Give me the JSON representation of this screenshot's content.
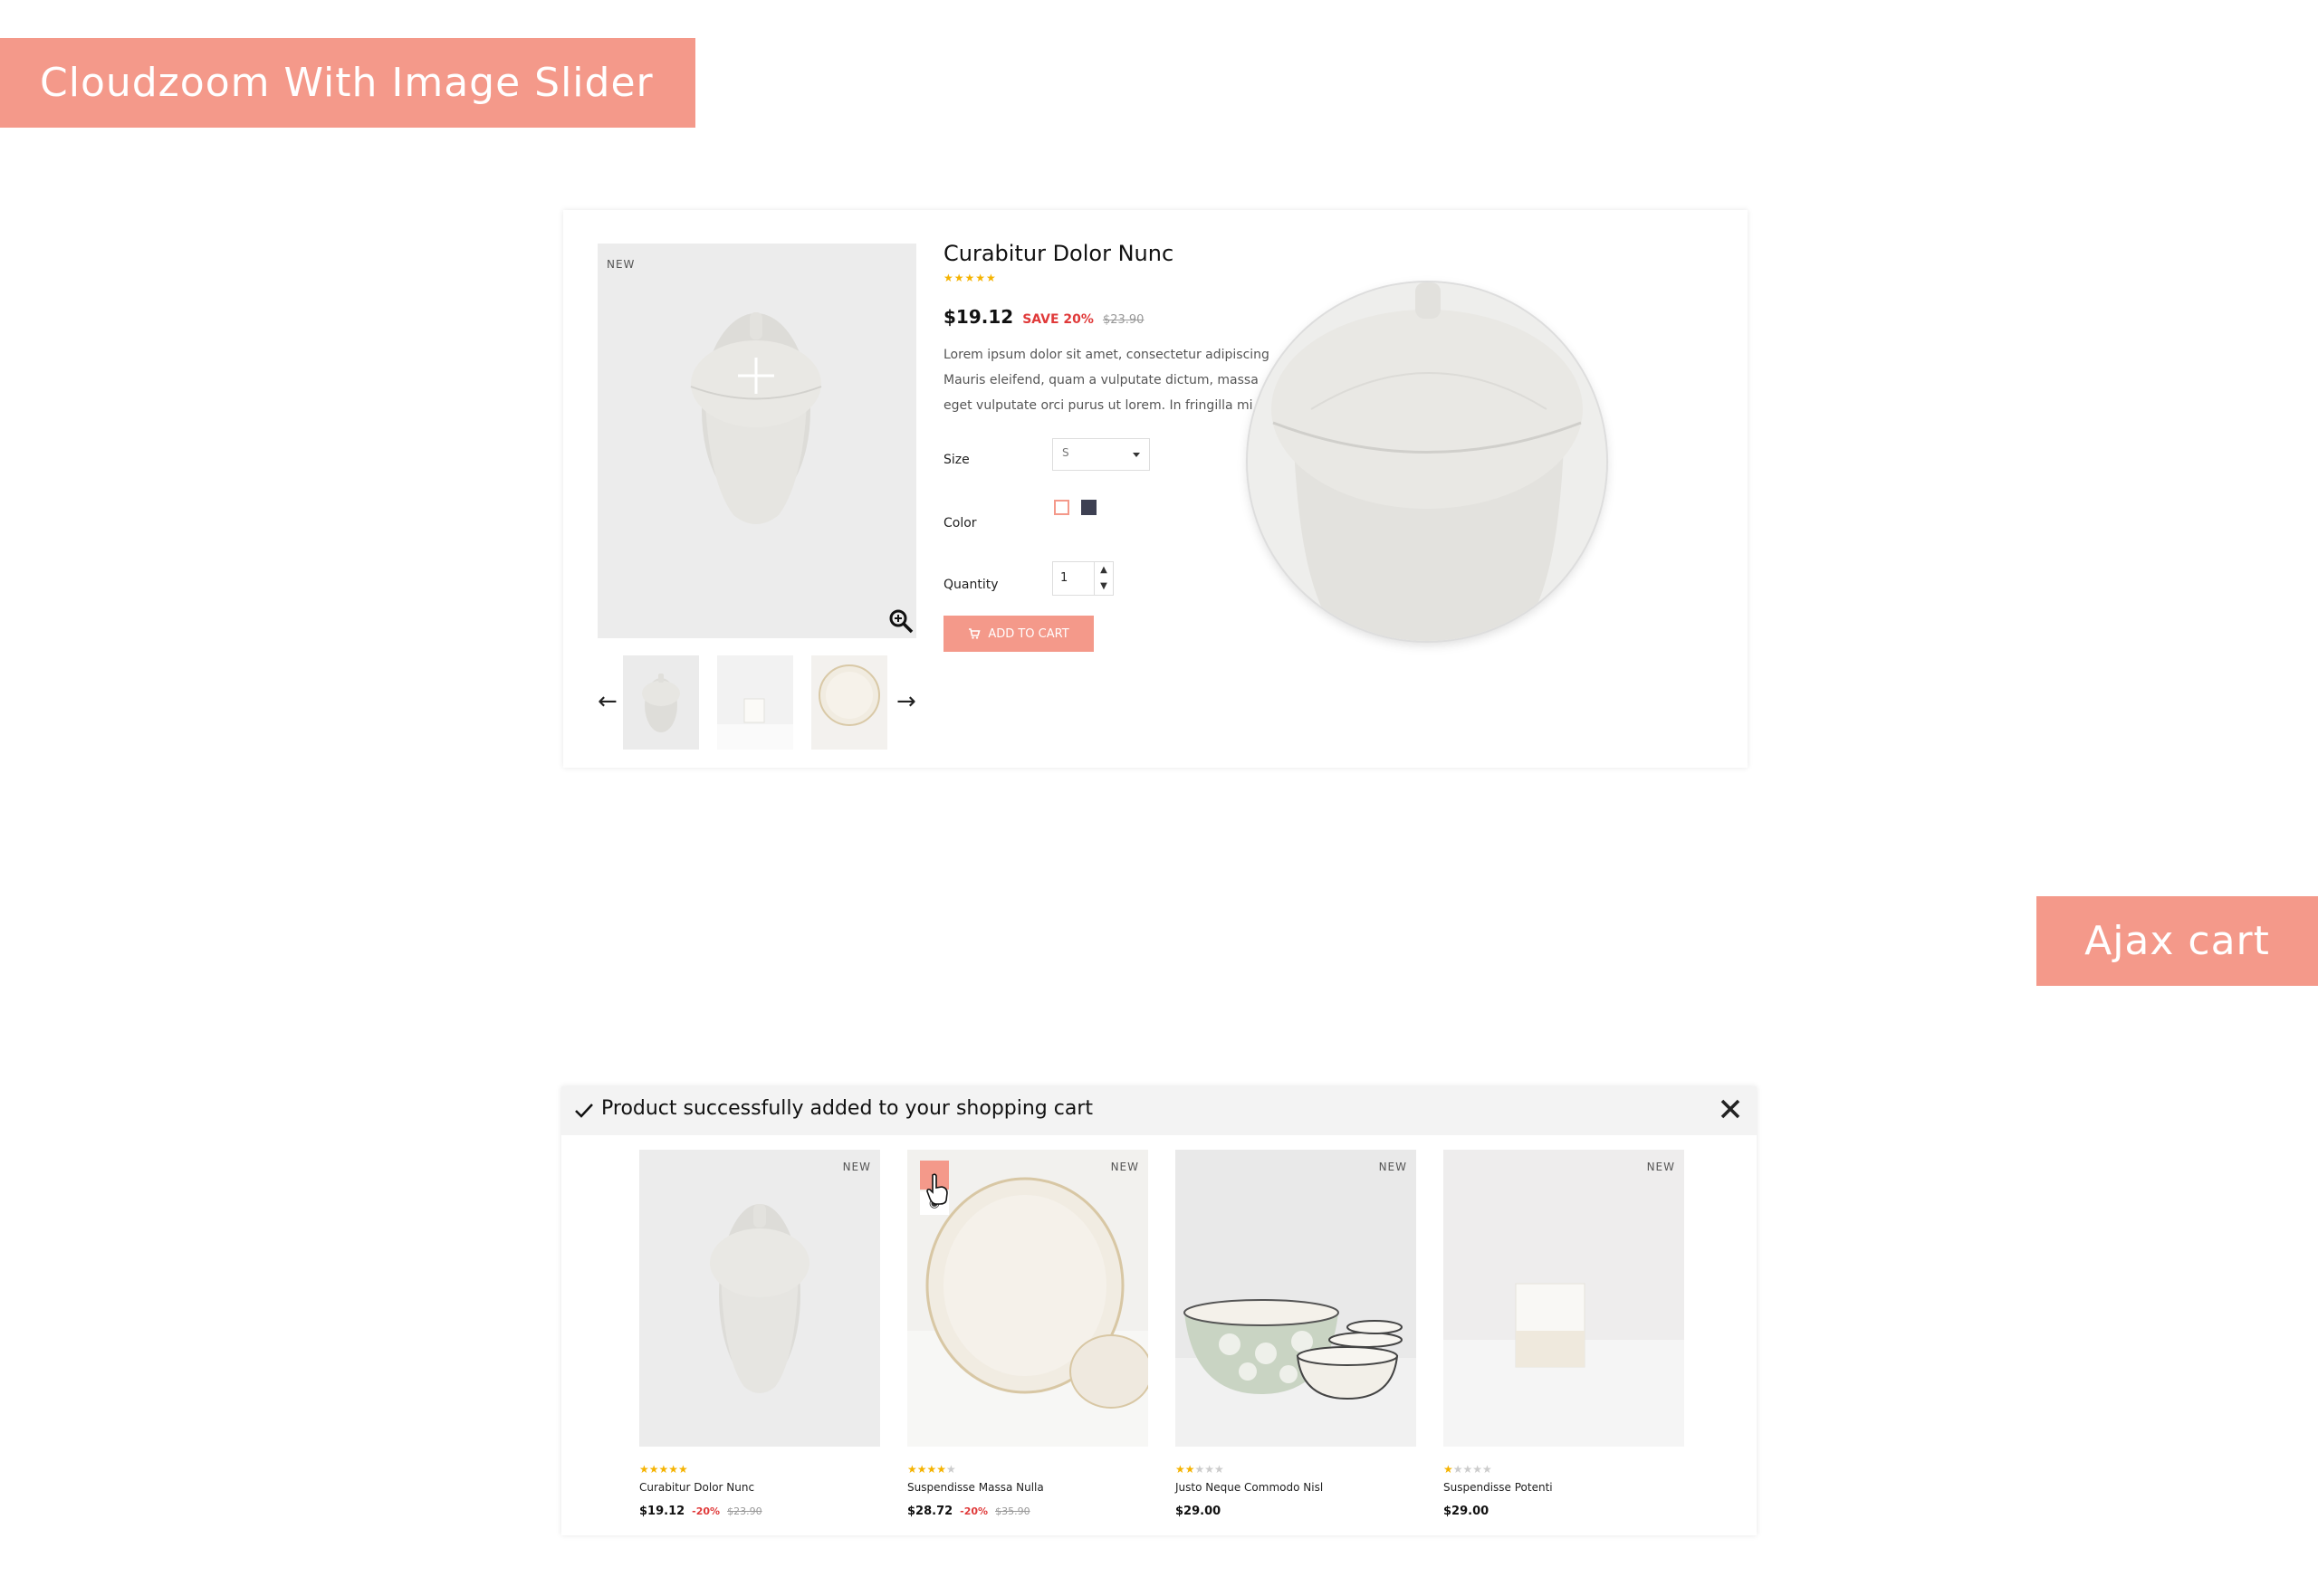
{
  "banners": {
    "cloudzoom": "Cloudzoom With Image Slider",
    "ajax": "Ajax cart"
  },
  "product": {
    "badge": "NEW",
    "title": "Curabitur Dolor Nunc",
    "rating": 5,
    "price": "$19.12",
    "save": "SAVE 20%",
    "old_price": "$23.90",
    "description": [
      "Lorem ipsum dolor sit amet, consectetur adipiscing",
      "Mauris eleifend, quam a vulputate dictum, massa",
      "eget vulputate orci purus ut lorem. In fringilla mi"
    ],
    "size_label": "Size",
    "size_value": "S",
    "color_label": "Color",
    "colors": [
      "#ffffff",
      "#3d4052"
    ],
    "qty_label": "Quantity",
    "qty_value": "1",
    "add_to_cart": "ADD TO CART",
    "prev_arrow": "←",
    "next_arrow": "→"
  },
  "cart": {
    "message": "Product successfully added to your shopping cart",
    "products": [
      {
        "badge": "NEW",
        "name": "Curabitur Dolor Nunc",
        "rating": 5,
        "price": "$19.12",
        "discount": "-20%",
        "old_price": "$23.90"
      },
      {
        "badge": "NEW",
        "name": "Suspendisse Massa Nulla",
        "rating": 4,
        "price": "$28.72",
        "discount": "-20%",
        "old_price": "$35.90"
      },
      {
        "badge": "NEW",
        "name": "Justo Neque Commodo Nisl",
        "rating": 2,
        "price": "$29.00",
        "discount": "",
        "old_price": ""
      },
      {
        "badge": "NEW",
        "name": "Suspendisse Potenti",
        "rating": 1,
        "price": "$29.00",
        "discount": "",
        "old_price": ""
      }
    ]
  },
  "colors": {
    "accent": "#f4998a",
    "star": "#f5b301",
    "sale": "#e03a3a"
  },
  "icons": [
    "zoom-in-icon",
    "cart-icon",
    "check-icon",
    "close-icon",
    "eye-icon",
    "pointer-hand-icon",
    "arrow-left-icon",
    "arrow-right-icon",
    "caret-down-icon"
  ]
}
